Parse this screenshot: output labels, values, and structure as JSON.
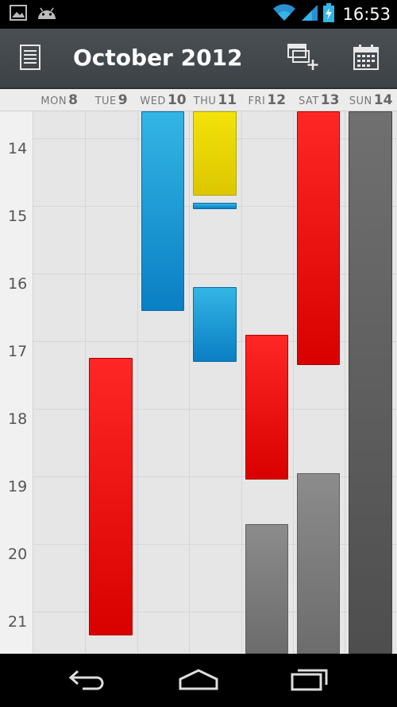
{
  "status_bar": {
    "time": "16:53",
    "icons_left": [
      "image-icon",
      "android-icon"
    ],
    "icons_right": [
      "wifi-icon",
      "signal-icon",
      "battery-charging-icon"
    ]
  },
  "action_bar": {
    "title": "October 2012",
    "menu_icon": "agenda-list-icon",
    "new_event_icon": "new-event-icon",
    "calendar_icon": "calendar-month-icon"
  },
  "days": [
    {
      "name": "MON",
      "num": "8"
    },
    {
      "name": "TUE",
      "num": "9"
    },
    {
      "name": "WED",
      "num": "10"
    },
    {
      "name": "THU",
      "num": "11"
    },
    {
      "name": "FRI",
      "num": "12"
    },
    {
      "name": "SAT",
      "num": "13"
    },
    {
      "name": "SUN",
      "num": "14"
    }
  ],
  "hours": [
    "14",
    "15",
    "16",
    "17",
    "18",
    "19",
    "20",
    "21"
  ],
  "colors": {
    "red": "#e60000",
    "blue": "#33b5e5",
    "yellow": "#e8d400",
    "gray": "#7a7a7a",
    "dark_gray": "#5a5a5a"
  },
  "events": [
    {
      "day": 2,
      "start": 13.6,
      "end": 16.55,
      "color": "blue"
    },
    {
      "day": 3,
      "start": 13.6,
      "end": 14.85,
      "color": "yellow"
    },
    {
      "day": 3,
      "start": 14.95,
      "end": 15.05,
      "color": "blue"
    },
    {
      "day": 3,
      "start": 16.2,
      "end": 17.3,
      "color": "blue"
    },
    {
      "day": 1,
      "start": 17.25,
      "end": 21.35,
      "color": "red"
    },
    {
      "day": 4,
      "start": 16.9,
      "end": 19.05,
      "color": "red"
    },
    {
      "day": 4,
      "start": 19.7,
      "end": 21.8,
      "color": "gray"
    },
    {
      "day": 5,
      "start": 13.6,
      "end": 17.35,
      "color": "red"
    },
    {
      "day": 5,
      "start": 18.95,
      "end": 21.8,
      "color": "gray"
    },
    {
      "day": 6,
      "start": 13.6,
      "end": 21.8,
      "color": "dark_gray"
    }
  ],
  "nav_bar": {
    "back_icon": "back-icon",
    "home_icon": "home-icon",
    "recents_icon": "recent-apps-icon"
  }
}
